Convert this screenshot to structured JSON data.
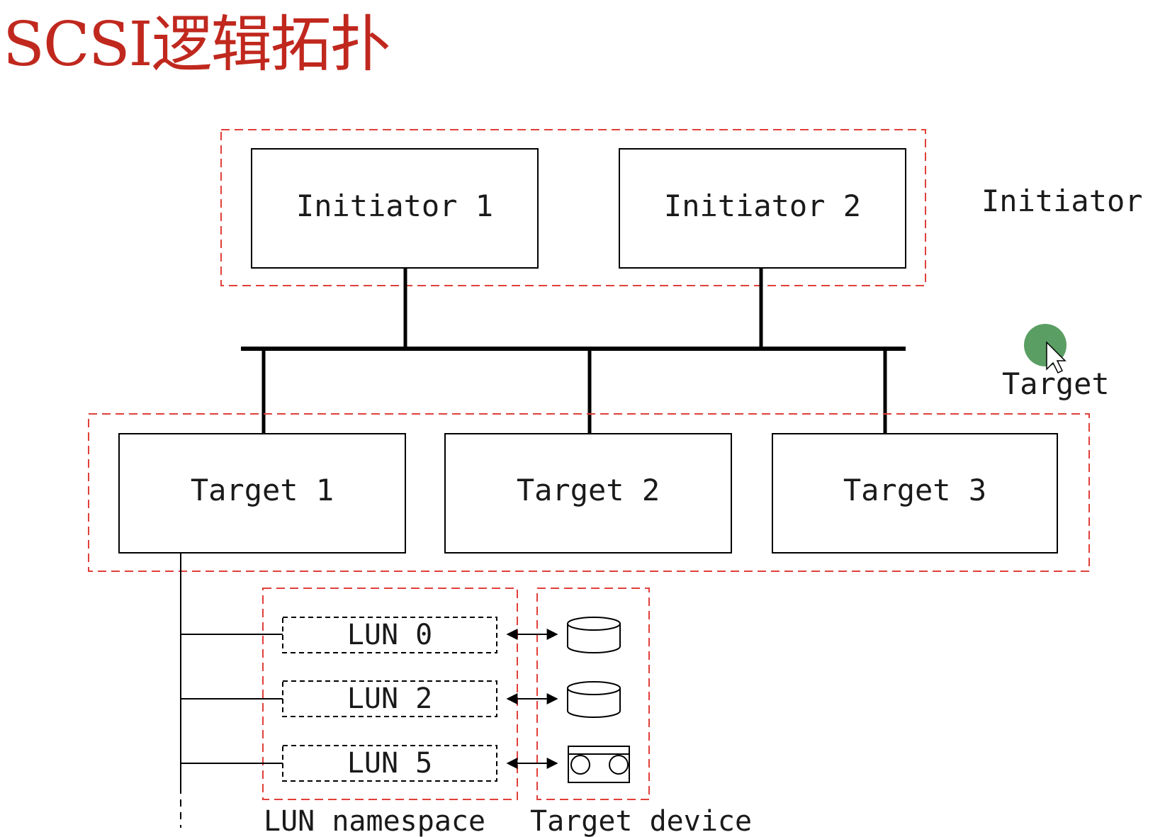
{
  "title": "SCSI逻辑拓扑",
  "colors": {
    "title": "#c0281e",
    "group_border": "#e0403a",
    "line": "#000000",
    "text": "#1a1a1a",
    "cursor_highlight": "#5a9e63"
  },
  "initiators": [
    "Initiator 1",
    "Initiator 2"
  ],
  "initiator_group_label": "Initiator",
  "targets": [
    "Target 1",
    "Target 2",
    "Target 3"
  ],
  "target_group_label": "Target",
  "luns": [
    "LUN 0",
    "LUN 2",
    "LUN 5"
  ],
  "lun_devices": [
    "disk-icon",
    "disk-icon",
    "tape-icon"
  ],
  "lun_namespace_label": "LUN namespace",
  "target_device_label": "Target device"
}
